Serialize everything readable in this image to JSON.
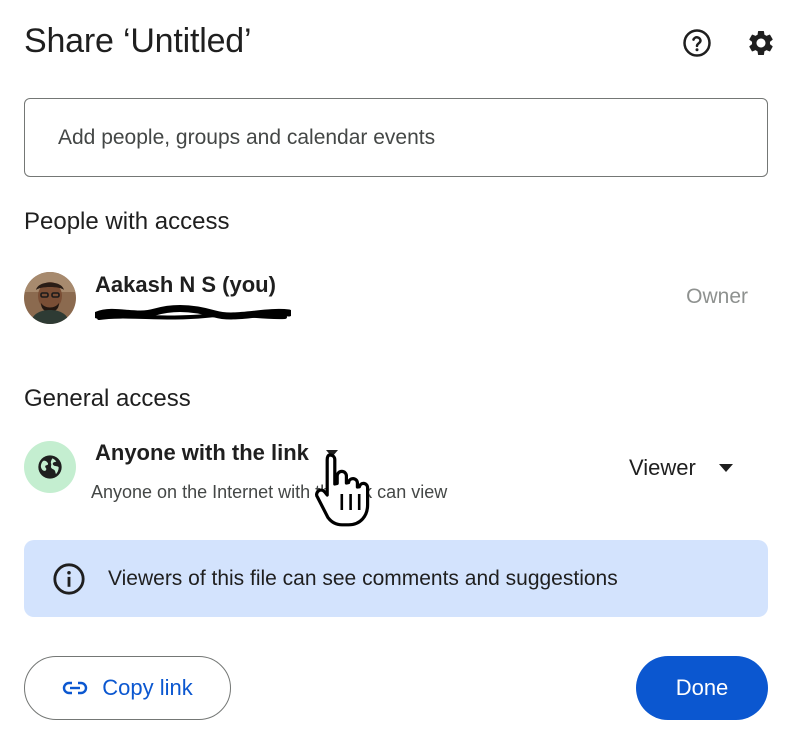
{
  "dialog": {
    "title": "Share ‘Untitled’",
    "help_icon": "help-circle-icon",
    "settings_icon": "gear-icon"
  },
  "add_people": {
    "placeholder": "Add people, groups and calendar events",
    "value": ""
  },
  "people_section": {
    "heading": "People with access",
    "people": [
      {
        "name": "Aakash N S (you)",
        "email": "redacted",
        "role": "Owner"
      }
    ]
  },
  "general_access": {
    "heading": "General access",
    "access_level": "Anyone with the link",
    "description": "Anyone on the Internet with the link can view",
    "role": "Viewer",
    "icon": "globe-icon"
  },
  "info_banner": {
    "text": "Viewers of this file can see comments and suggestions",
    "icon": "info-icon"
  },
  "actions": {
    "copy_link_label": "Copy link",
    "copy_icon": "link-icon",
    "done_label": "Done"
  },
  "colors": {
    "primary": "#0b57d0",
    "banner_bg": "#d3e3fd",
    "globe_bg": "#c4eed0",
    "muted_text": "#8e918f"
  }
}
